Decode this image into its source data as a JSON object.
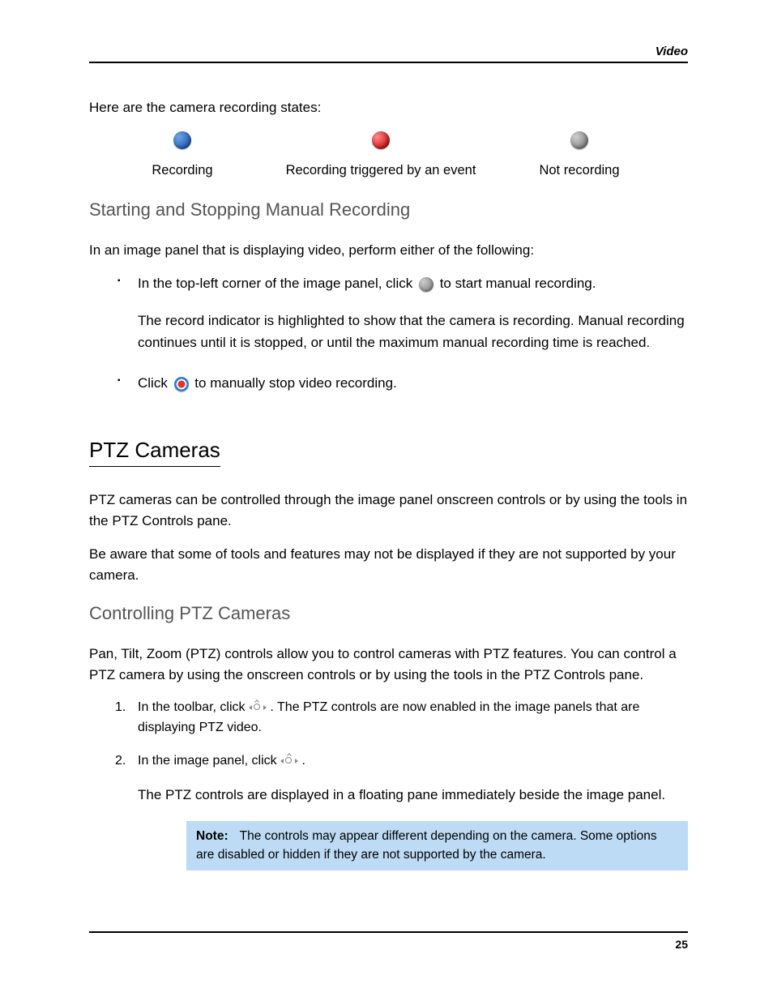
{
  "header": {
    "section": "Video"
  },
  "intro": "Here are the camera recording states:",
  "states": {
    "blue": {
      "label": "Recording"
    },
    "red": {
      "label": "Recording triggered by an event"
    },
    "gray": {
      "label": "Not recording"
    }
  },
  "sec1": {
    "heading": "Starting and Stopping Manual Recording",
    "lead": "In an image panel that is displaying video, perform either of the following:",
    "b1_pre": "In the top-left corner of the image panel, click ",
    "b1_post": " to start manual recording.",
    "b1_sub": "The record indicator is highlighted to show that the camera is recording. Manual recording continues until it is stopped, or until the maximum manual recording time is reached.",
    "b2_pre": "Click ",
    "b2_post": " to manually stop video recording."
  },
  "sec2": {
    "heading": "PTZ Cameras",
    "p1": "PTZ cameras can be controlled through the image panel onscreen controls or by using the tools in the PTZ Controls pane.",
    "p2": "Be aware that some of tools and features may not be displayed if they are not supported by your camera."
  },
  "sec3": {
    "heading": "Controlling PTZ Cameras",
    "lead": "Pan, Tilt, Zoom (PTZ) controls allow you to control cameras with PTZ features. You can control a PTZ camera by using the onscreen controls or by using the tools in the PTZ Controls pane.",
    "o1_marker": "1.",
    "o1_pre": "In the toolbar, click ",
    "o1_post": ". The PTZ controls are now enabled in the image panels that are displaying PTZ video.",
    "o2_marker": "2.",
    "o2_pre": "In the image panel, click ",
    "o2_post": ".",
    "o2_sub": "The PTZ controls are displayed in a floating pane immediately beside the image panel.",
    "note_label": "Note:",
    "note_text": "The controls may appear different depending on the camera. Some options are disabled or hidden if they are not supported by the camera."
  },
  "footer": {
    "page": "25"
  }
}
